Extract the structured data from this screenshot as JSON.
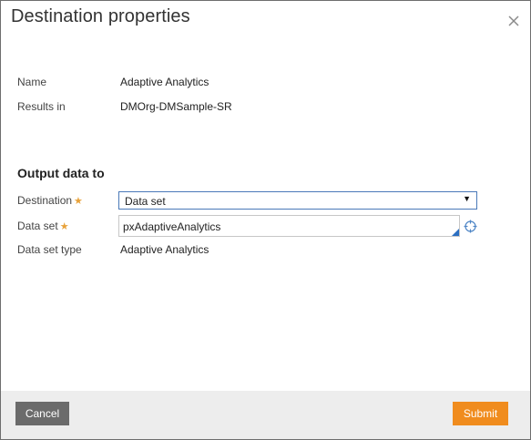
{
  "dialog": {
    "title": "Destination properties",
    "close_icon": "close-icon"
  },
  "info": {
    "name_label": "Name",
    "name_value": "Adaptive Analytics",
    "results_label": "Results in",
    "results_value": "DMOrg-DMSample-SR"
  },
  "output": {
    "section_title": "Output data to",
    "destination_label": "Destination",
    "destination_value": "Data set",
    "dataset_label": "Data set",
    "dataset_value": "pxAdaptiveAnalytics",
    "dataset_type_label": "Data set type",
    "dataset_type_value": "Adaptive Analytics",
    "required_marker": "★",
    "dropdown_arrow": "▼",
    "crosshair_icon": "crosshair-icon"
  },
  "footer": {
    "cancel_label": "Cancel",
    "submit_label": "Submit"
  },
  "colors": {
    "accent": "#f08c1e",
    "required": "#e8a23a",
    "select_border": "#4a79b8",
    "cancel_bg": "#6b6b6b",
    "footer_bg": "#ededed",
    "corner_blue": "#2c6fc1"
  }
}
